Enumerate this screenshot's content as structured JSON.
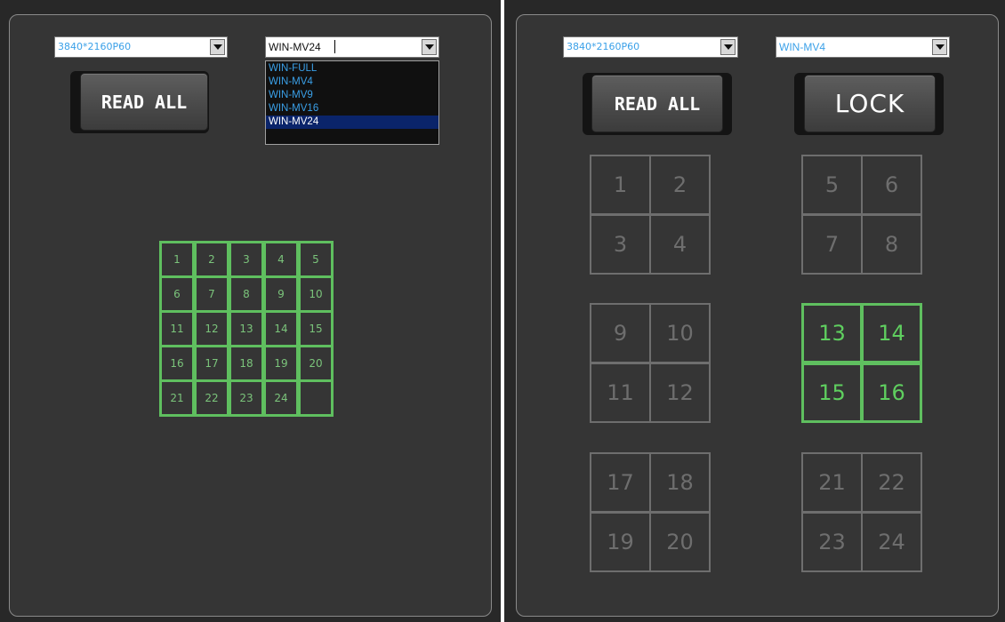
{
  "left": {
    "resolution": {
      "value": "3840*2160P60"
    },
    "mode": {
      "value": "WIN-MV24",
      "options": [
        "WIN-FULL",
        "WIN-MV4",
        "WIN-MV9",
        "WIN-MV16",
        "WIN-MV24"
      ],
      "selected_index": 4
    },
    "read_all_label": "READ ALL",
    "grid_cells": [
      "1",
      "2",
      "3",
      "4",
      "5",
      "6",
      "7",
      "8",
      "9",
      "10",
      "11",
      "12",
      "13",
      "14",
      "15",
      "16",
      "17",
      "18",
      "19",
      "20",
      "21",
      "22",
      "23",
      "24",
      ""
    ]
  },
  "right": {
    "resolution": {
      "value": "3840*2160P60"
    },
    "mode": {
      "value": "WIN-MV4"
    },
    "read_all_label": "READ ALL",
    "lock_label": "LOCK",
    "groups": [
      {
        "cells": [
          "1",
          "2",
          "3",
          "4"
        ],
        "active": false
      },
      {
        "cells": [
          "5",
          "6",
          "7",
          "8"
        ],
        "active": false
      },
      {
        "cells": [
          "9",
          "10",
          "11",
          "12"
        ],
        "active": false
      },
      {
        "cells": [
          "13",
          "14",
          "15",
          "16"
        ],
        "active": true
      },
      {
        "cells": [
          "17",
          "18",
          "19",
          "20"
        ],
        "active": false
      },
      {
        "cells": [
          "21",
          "22",
          "23",
          "24"
        ],
        "active": false
      }
    ]
  },
  "colors": {
    "panel_bg": "#353535",
    "active_green": "#5fbf5f",
    "inactive_gray": "#6e6e6e",
    "combo_text_blue": "#3aa0e8",
    "selected_item_bg": "#0a246a"
  }
}
